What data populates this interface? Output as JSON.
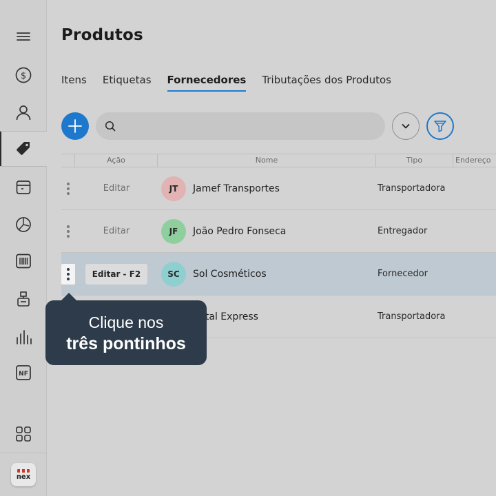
{
  "page": {
    "title": "Produtos"
  },
  "sidebar": {
    "items": [
      {
        "icon": "menu-icon"
      },
      {
        "icon": "dollar-circle-icon"
      },
      {
        "icon": "user-icon"
      },
      {
        "icon": "tag-icon",
        "active": true
      },
      {
        "icon": "box-icon"
      },
      {
        "icon": "pie-chart-icon"
      },
      {
        "icon": "barcode-icon"
      },
      {
        "icon": "cash-register-icon"
      },
      {
        "icon": "bar-chart-icon"
      },
      {
        "icon": "nf-icon",
        "label": "NF"
      },
      {
        "icon": "apps-grid-icon"
      }
    ],
    "logo": {
      "text": "nex",
      "color": "#c63a2c"
    }
  },
  "tabs": [
    {
      "label": "Itens"
    },
    {
      "label": "Etiquetas"
    },
    {
      "label": "Fornecedores",
      "active": true
    },
    {
      "label": "Tributações dos Produtos"
    }
  ],
  "toolbar": {
    "search_placeholder": "",
    "accent": "#1e78cc"
  },
  "table": {
    "columns": [
      {
        "label": "Ação"
      },
      {
        "label": "Nome"
      },
      {
        "label": "Tipo"
      },
      {
        "label": "Endereço"
      }
    ],
    "rows": [
      {
        "action": "Editar",
        "initials": "JT",
        "name": "Jamef Transportes",
        "tipo": "Transportadora",
        "avatar_color": "#e1b3b3"
      },
      {
        "action": "Editar",
        "initials": "JF",
        "name": "João Pedro Fonseca",
        "tipo": "Entregador",
        "avatar_color": "#8fcf9e"
      },
      {
        "action": "Editar - F2",
        "initials": "SC",
        "name": "Sol Cosméticos",
        "tipo": "Fornecedor",
        "avatar_color": "#8fcfcf",
        "selected": true
      },
      {
        "action": "",
        "initials": "",
        "name": "ital Express",
        "tipo": "Transportadora"
      }
    ]
  },
  "tooltip": {
    "line1": "Clique nos",
    "line2": "três pontinhos"
  }
}
